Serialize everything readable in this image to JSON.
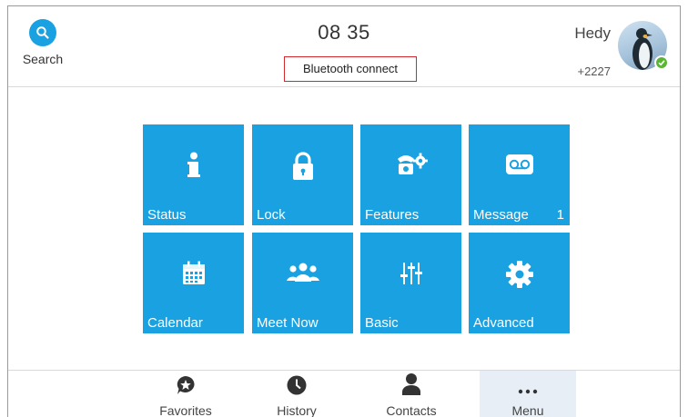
{
  "header": {
    "search_label": "Search",
    "time": "08 35",
    "status_text": "Bluetooth connect"
  },
  "user": {
    "name": "Hedy",
    "number": "+2227",
    "presence": "available",
    "presence_color": "#5bb534"
  },
  "tiles": [
    {
      "label": "Status",
      "icon": "info-icon",
      "badge": ""
    },
    {
      "label": "Lock",
      "icon": "lock-icon",
      "badge": ""
    },
    {
      "label": "Features",
      "icon": "phone-gear-icon",
      "badge": ""
    },
    {
      "label": "Message",
      "icon": "voicemail-icon",
      "badge": "1"
    },
    {
      "label": "Calendar",
      "icon": "calendar-icon",
      "badge": ""
    },
    {
      "label": "Meet Now",
      "icon": "group-icon",
      "badge": ""
    },
    {
      "label": "Basic",
      "icon": "sliders-icon",
      "badge": ""
    },
    {
      "label": "Advanced",
      "icon": "gear-icon",
      "badge": ""
    }
  ],
  "nav": [
    {
      "label": "Favorites",
      "icon": "star-bubble-icon",
      "active": false
    },
    {
      "label": "History",
      "icon": "clock-icon",
      "active": false
    },
    {
      "label": "Contacts",
      "icon": "person-icon",
      "active": false
    },
    {
      "label": "Menu",
      "icon": "more-dots-icon",
      "active": true
    }
  ],
  "colors": {
    "accent": "#1aa1e1",
    "highlight_border": "#d3282e",
    "nav_active_bg": "#e7eef6"
  }
}
